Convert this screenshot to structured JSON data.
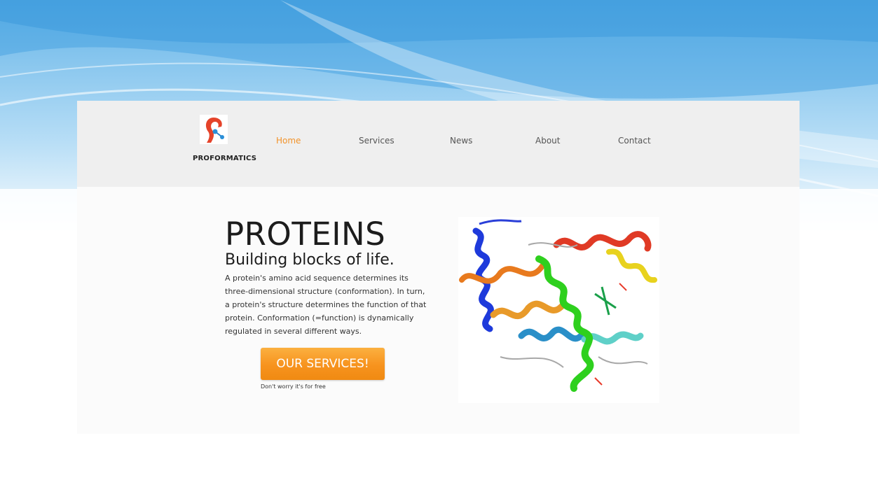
{
  "brand": {
    "name": "PROFORMATICS",
    "logo_icon": "protein-logo-icon",
    "accent": "#f2932a"
  },
  "nav": {
    "items": [
      "Home",
      "Services",
      "News",
      "About",
      "Contact"
    ],
    "active": "Home"
  },
  "hero": {
    "title": "PROTEINS",
    "subtitle": "Building blocks of life.",
    "body": "A protein's amino acid sequence determines its three-dimensional structure (conformation). In turn, a protein's structure determines the function of that protein. Conformation (=function) is dynamically regulated in several different ways.",
    "cta_label": "OUR SERVICES!",
    "cta_note": "Don't worry it's for free",
    "cta_color": "#f7931e"
  },
  "image": {
    "icon": "protein-structure-image"
  }
}
